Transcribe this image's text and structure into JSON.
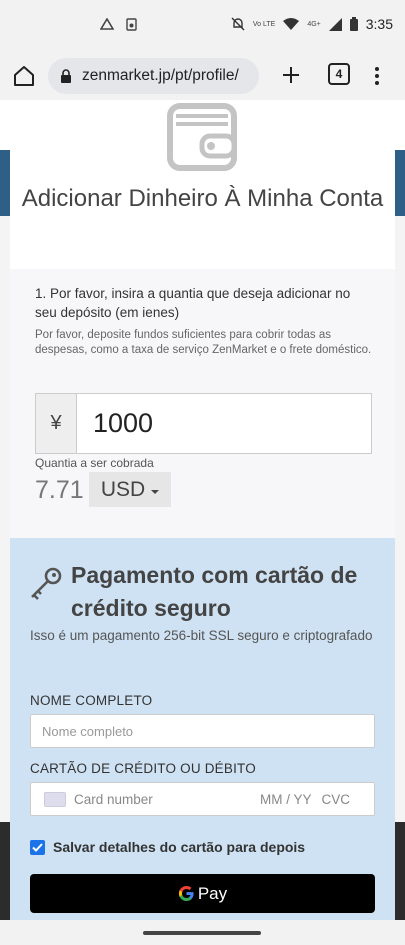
{
  "status_bar": {
    "time": "3:35",
    "network_label": "Vo LTE",
    "signal_label": "4G+"
  },
  "browser": {
    "url": "zenmarket.jp/pt/profile/",
    "tab_count": "4"
  },
  "modal": {
    "title": "Adicionar Dinheiro À Minha Conta",
    "step1": "1. Por favor, insira a quantia que deseja adicionar no seu depósito (em ienes)",
    "step1_hint": "Por favor, deposite fundos suficientes para cobrir todas as despesas, como a taxa de serviço ZenMarket e o frete doméstico.",
    "yen_symbol": "¥",
    "amount": "1000",
    "charge_label": "Quantia a ser cobrada",
    "charge_amount": "7.71",
    "currency": "USD"
  },
  "payment": {
    "title": "Pagamento com cartão de crédito seguro",
    "subtitle": "Isso é um pagamento 256-bit SSL seguro e criptografado",
    "full_name_label": "NOME COMPLETO",
    "full_name_placeholder": "Nome completo",
    "card_label": "CARTÃO DE CRÉDITO OU DÉBITO",
    "card_number_placeholder": "Card number",
    "card_expiry_placeholder": "MM / YY",
    "card_cvc_placeholder": "CVC",
    "save_details_label": "Salvar detalhes do cartão para depois",
    "save_details_checked": true,
    "gpay_label": "Pay"
  },
  "colors": {
    "pay_section_bg": "#cfe2f3",
    "checkbox_accent": "#1a73e8",
    "gpay_button": "#000000"
  }
}
